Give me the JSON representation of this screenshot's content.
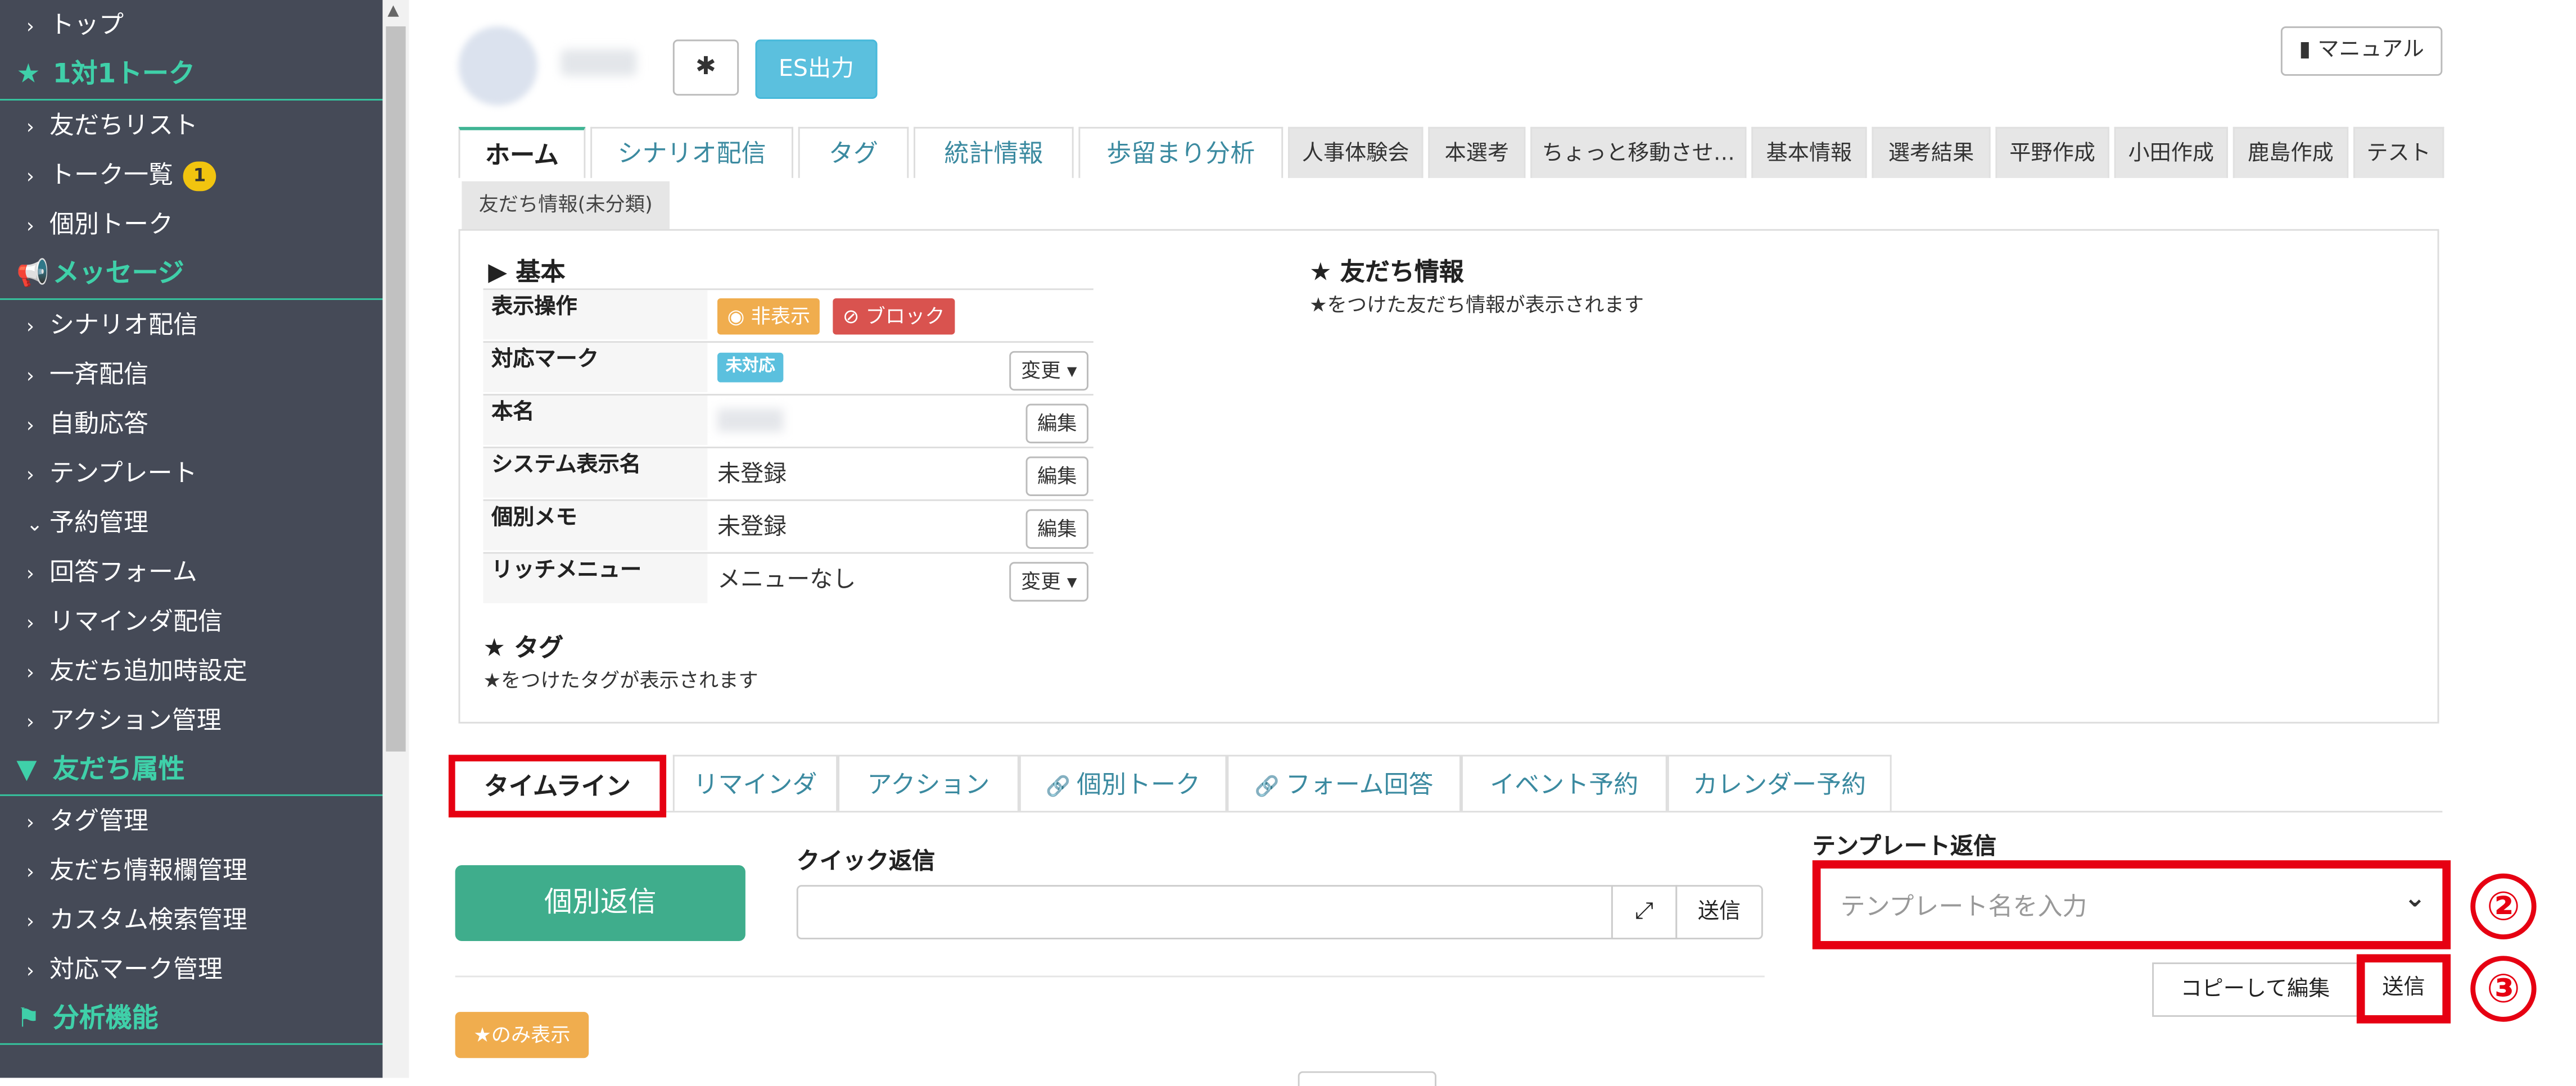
{
  "sidebar": {
    "items": [
      {
        "type": "item",
        "caret": "›",
        "label": "トップ"
      },
      {
        "type": "head",
        "icon": "star-icon",
        "glyph": "★",
        "label": "1対1トーク"
      },
      {
        "type": "item",
        "caret": "›",
        "label": "友だちリスト"
      },
      {
        "type": "item",
        "caret": "›",
        "label": "トーク一覧",
        "badge": "1"
      },
      {
        "type": "item",
        "caret": "›",
        "label": "個別トーク"
      },
      {
        "type": "head",
        "icon": "megaphone-icon",
        "glyph": "📢",
        "label": "メッセージ"
      },
      {
        "type": "item",
        "caret": "›",
        "label": "シナリオ配信"
      },
      {
        "type": "item",
        "caret": "›",
        "label": "一斉配信"
      },
      {
        "type": "item",
        "caret": "›",
        "label": "自動応答"
      },
      {
        "type": "item",
        "caret": "›",
        "label": "テンプレート"
      },
      {
        "type": "item",
        "caret": "⌄",
        "label": "予約管理"
      },
      {
        "type": "item",
        "caret": "›",
        "label": "回答フォーム"
      },
      {
        "type": "item",
        "caret": "›",
        "label": "リマインダ配信"
      },
      {
        "type": "item",
        "caret": "›",
        "label": "友だち追加時設定"
      },
      {
        "type": "item",
        "caret": "›",
        "label": "アクション管理"
      },
      {
        "type": "head",
        "icon": "filter-icon",
        "glyph": "▼",
        "label": "友だち属性"
      },
      {
        "type": "item",
        "caret": "›",
        "label": "タグ管理"
      },
      {
        "type": "item",
        "caret": "›",
        "label": "友だち情報欄管理"
      },
      {
        "type": "item",
        "caret": "›",
        "label": "カスタム検索管理"
      },
      {
        "type": "item",
        "caret": "›",
        "label": "対応マーク管理"
      },
      {
        "type": "head",
        "icon": "flag-icon",
        "glyph": "⚑",
        "label": "分析機能"
      }
    ]
  },
  "header": {
    "es_button": "ES出力",
    "manual_button": "マニュアル"
  },
  "tabs_top": [
    {
      "label": "ホーム",
      "active": true,
      "gray": false
    },
    {
      "label": "シナリオ配信",
      "gray": false
    },
    {
      "label": "タグ",
      "gray": false
    },
    {
      "label": "統計情報",
      "gray": false
    },
    {
      "label": "歩留まり分析",
      "gray": false
    },
    {
      "label": "人事体験会",
      "gray": true
    },
    {
      "label": "本選考",
      "gray": true
    },
    {
      "label": "ちょっと移動させ…",
      "gray": true
    },
    {
      "label": "基本情報",
      "gray": true
    },
    {
      "label": "選考結果",
      "gray": true
    },
    {
      "label": "平野作成",
      "gray": true
    },
    {
      "label": "小田作成",
      "gray": true
    },
    {
      "label": "鹿島作成",
      "gray": true
    },
    {
      "label": "テスト",
      "gray": true
    }
  ],
  "tab_row2": "友だち情報(未分類)",
  "basic": {
    "title": "▶ 基本",
    "rows": {
      "display": {
        "label": "表示操作",
        "hide": "非表示",
        "block": "ブロック"
      },
      "mark": {
        "label": "対応マーク",
        "value": "未対応",
        "button": "変更"
      },
      "realname": {
        "label": "本名",
        "button": "編集"
      },
      "sysname": {
        "label": "システム表示名",
        "value": "未登録",
        "button": "編集"
      },
      "memo": {
        "label": "個別メモ",
        "value": "未登録",
        "button": "編集"
      },
      "richmenu": {
        "label": "リッチメニュー",
        "value": "メニューなし",
        "button": "変更"
      }
    }
  },
  "friend_info": {
    "title": "★ 友だち情報",
    "subtitle": "★をつけた友だち情報が表示されます"
  },
  "tag_section": {
    "title": "★ タグ",
    "subtitle": "★をつけたタグが表示されます"
  },
  "tabs_lower": [
    {
      "label": "タイムライン",
      "active": true
    },
    {
      "label": "リマインダ"
    },
    {
      "label": "アクション"
    },
    {
      "label": "個別トーク",
      "link": true
    },
    {
      "label": "フォーム回答",
      "link": true
    },
    {
      "label": "イベント予約"
    },
    {
      "label": "カレンダー予約"
    }
  ],
  "reply": {
    "individual_button": "個別返信",
    "quick_label": "クイック返信",
    "quick_placeholder": "",
    "send_label": "送信",
    "star_only_button": "★のみ表示"
  },
  "template": {
    "label": "テンプレート返信",
    "placeholder": "テンプレート名を入力",
    "copy_edit_button": "コピーして編集",
    "send_button": "送信"
  },
  "annotations": {
    "circle2": "②",
    "circle3": "③"
  },
  "colors": {
    "sidebar_bg": "#454a57",
    "sidebar_accent": "#3fd0a9",
    "highlight_red": "#e60012",
    "reply_green": "#3fad8c"
  }
}
